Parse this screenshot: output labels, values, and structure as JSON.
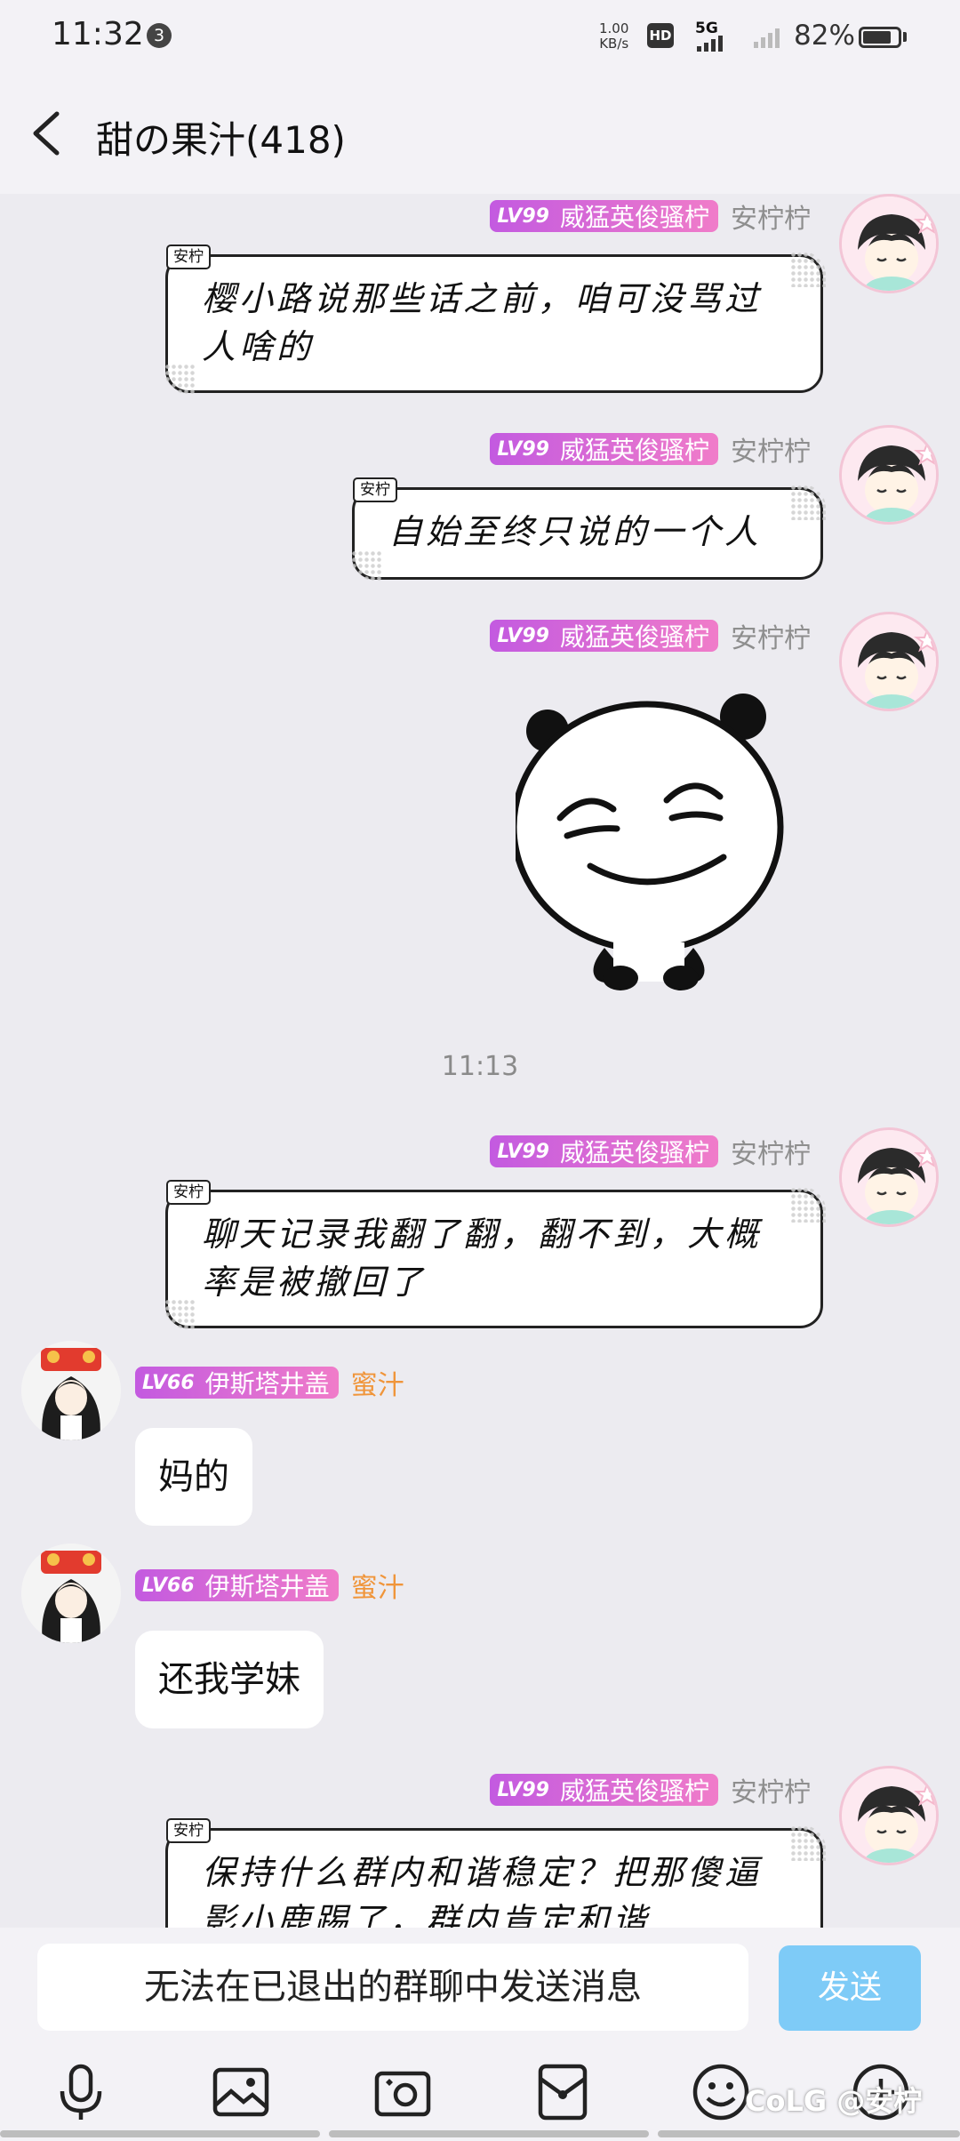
{
  "status_bar": {
    "time": "11:32",
    "notification_count": "3",
    "net_speed_value": "1.00",
    "net_speed_unit": "KB/s",
    "hd_label": "HD",
    "network": "5G",
    "battery_percent": "82%",
    "battery_level": 0.82
  },
  "header": {
    "title": "甜の果汁(418)"
  },
  "timestamp": "11:13",
  "sender_right": {
    "level": "LV99",
    "title": "威猛英俊骚柠",
    "nickname": "安柠柠"
  },
  "sender_left": {
    "level": "LV66",
    "title": "伊斯塔井盖",
    "nickname": "蜜汁"
  },
  "bubble_tag": "安柠",
  "messages": [
    {
      "side": "right",
      "text": "樱小路说那些话之前，咱可没骂过人啥的"
    },
    {
      "side": "right",
      "text": "自始至终只说的一个人"
    },
    {
      "side": "right",
      "type": "sticker",
      "sticker": "panda-smile"
    },
    {
      "side": "right",
      "text": "聊天记录我翻了翻，翻不到，大概率是被撤回了"
    },
    {
      "side": "left",
      "text": "妈的"
    },
    {
      "side": "left",
      "text": "还我学妹"
    },
    {
      "side": "right",
      "text": "保持什么群内和谐稳定？把那傻逼影小鹿踢了，群内肯定和谐"
    }
  ],
  "input": {
    "disabled_text": "无法在已退出的群聊中发送消息",
    "send_label": "发送"
  },
  "toolbar_icons": [
    "microphone-icon",
    "image-icon",
    "camera-icon",
    "red-packet-icon",
    "emoji-icon",
    "add-icon"
  ],
  "watermark": "CoLG @安柠"
}
